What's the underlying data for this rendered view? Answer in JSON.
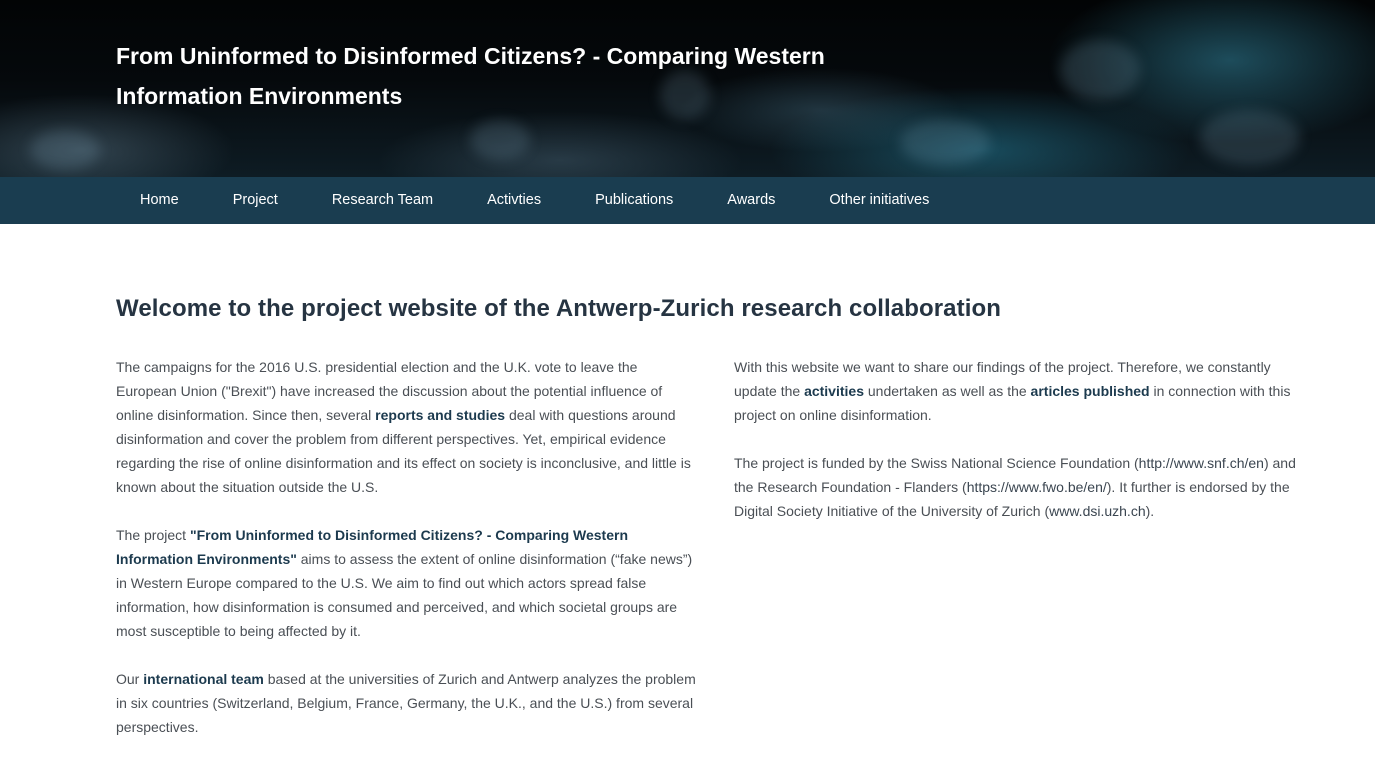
{
  "banner": {
    "title": "From Uninformed to Disinformed Citizens? - Comparing Western Information Environments"
  },
  "nav": {
    "items": [
      "Home",
      "Project",
      "Research Team",
      "Activties",
      "Publications",
      "Awards",
      "Other initiatives"
    ]
  },
  "main": {
    "title": "Welcome to the project website of the Antwerp-Zurich research collaboration",
    "left": {
      "p1_a": "The campaigns for the 2016 U.S. presidential election and the U.K. vote to leave the European Union (\"Brexit\") have increased the discussion about the potential influence of online disinformation. Since then, several ",
      "p1_link": "reports and studies",
      "p1_b": " deal with questions around disinformation and cover the problem from different perspectives. Yet, empirical evidence regarding the rise of online disinformation and its effect on society is inconclusive, and little is known about the situation outside the U.S.",
      "p2_a": "The project ",
      "p2_bold": "\"From Uninformed to Disinformed Citizens? - Comparing Western Information Environments\"",
      "p2_b": " aims to assess the extent of online disinformation (“fake news”) in Western Europe compared to the U.S. We aim to find out which actors spread false information, how disinformation is consumed and perceived, and which societal groups are most susceptible to being affected by it.",
      "p3_a": "Our ",
      "p3_link": "international team",
      "p3_b": " based at the universities of Zurich and Antwerp analyzes the problem in six countries (Switzerland, Belgium, France, Germany, the U.K., and the U.S.) from several perspectives."
    },
    "right": {
      "p1_a": "With this website we want to share our findings of the project. Therefore, we constantly update the ",
      "p1_link1": "activities",
      "p1_b": " undertaken as well as the ",
      "p1_link2": "articles published",
      "p1_c": " in connection with this project on online disinformation.",
      "p2_a": "The project is funded by the Swiss National Science Foundation (",
      "p2_link1": "http://www.snf.ch/en",
      "p2_b": ") and the Research Foundation - Flanders (",
      "p2_link2": "https://www.fwo.be/en/",
      "p2_c": "). It further is endorsed by the Digital Society Initiative of the University of Zurich (",
      "p2_link3": "www.dsi.uzh.ch",
      "p2_d": ")."
    }
  }
}
